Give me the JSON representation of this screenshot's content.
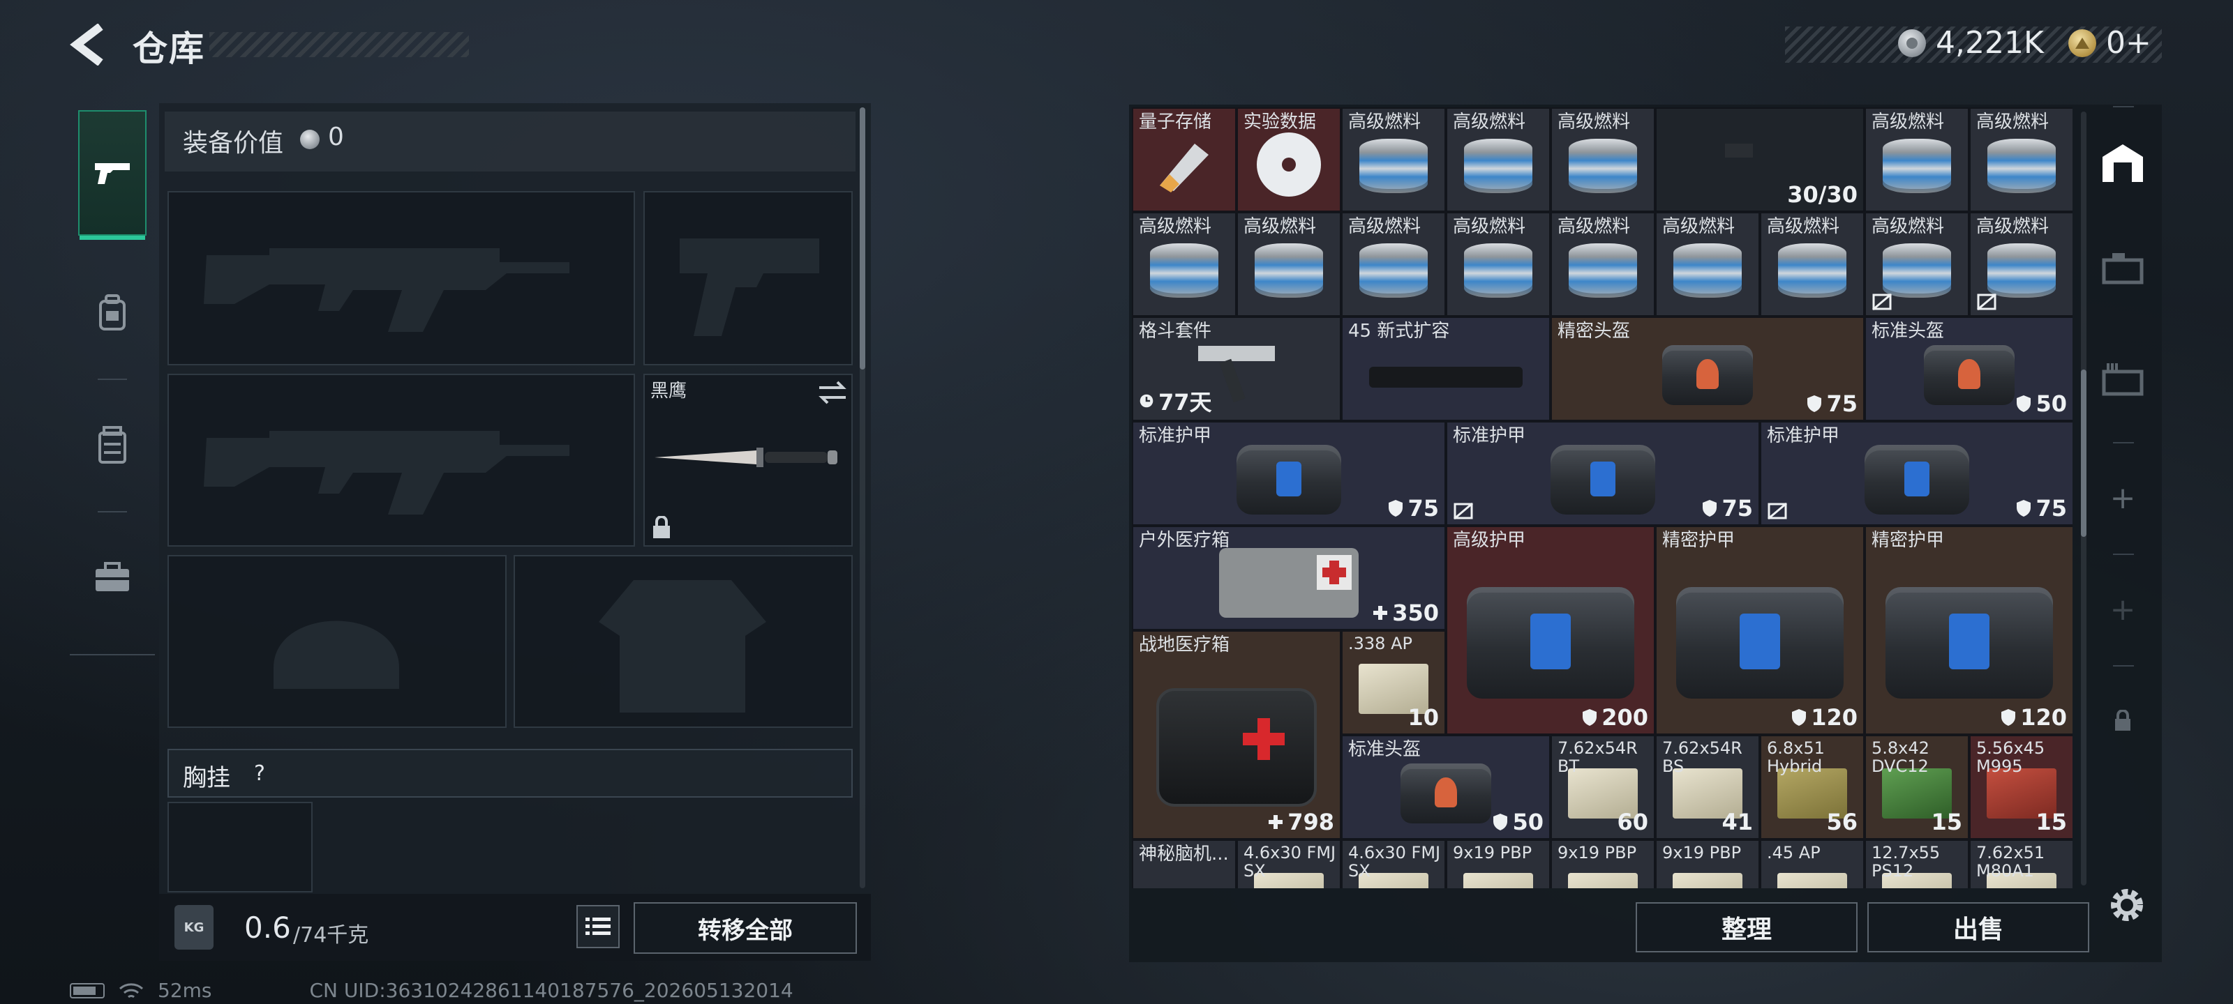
{
  "header": {
    "title": "仓库",
    "currency_silver": "4,221K",
    "currency_gold": "0+"
  },
  "loadout": {
    "equip_value_label": "装备价值",
    "equip_value": "0",
    "melee_name": "黑鹰",
    "chest_label": "胸挂",
    "chest_help": "?",
    "weight_icon_text": "KG",
    "weight_current": "0.6",
    "weight_max": "/74千克",
    "transfer_all": "转移全部"
  },
  "stash": {
    "sort_label": "整理",
    "sell_label": "出售",
    "items": [
      {
        "name": "量子存储",
        "val": "",
        "kind": "usb",
        "color": "c-red"
      },
      {
        "name": "实验数据",
        "val": "",
        "kind": "disc",
        "color": "c-red"
      },
      {
        "name": "高级燃料",
        "val": "",
        "kind": "can",
        "color": "c-norm"
      },
      {
        "name": "高级燃料",
        "val": "",
        "kind": "can",
        "color": "c-norm"
      },
      {
        "name": "高级燃料",
        "val": "",
        "kind": "can",
        "color": "c-norm"
      },
      {
        "name": "",
        "val": "30/30",
        "kind": "mag",
        "color": "c-dark"
      },
      {
        "name": "高级燃料",
        "val": "",
        "kind": "can",
        "color": "c-norm"
      },
      {
        "name": "高级燃料",
        "val": "",
        "kind": "can",
        "color": "c-norm"
      },
      {
        "name": "高级燃料",
        "val": "",
        "kind": "can",
        "color": "c-norm"
      },
      {
        "name": "高级燃料",
        "val": "",
        "kind": "can",
        "color": "c-norm"
      },
      {
        "name": "高级燃料",
        "val": "",
        "kind": "can",
        "color": "c-norm"
      },
      {
        "name": "高级燃料",
        "val": "",
        "kind": "can",
        "color": "c-norm"
      },
      {
        "name": "高级燃料",
        "val": "",
        "kind": "can",
        "color": "c-norm"
      },
      {
        "name": "高级燃料",
        "val": "",
        "kind": "can",
        "color": "c-norm"
      },
      {
        "name": "高级燃料",
        "val": "",
        "kind": "can",
        "color": "c-norm"
      },
      {
        "name": "高级燃料",
        "val": "",
        "kind": "can",
        "color": "c-norm",
        "flag": true
      },
      {
        "name": "高级燃料",
        "val": "",
        "kind": "can",
        "color": "c-norm",
        "flag": true
      },
      {
        "name": "格斗套件",
        "val": "77天",
        "kind": "gun",
        "color": "c-norm",
        "valicon": "clock"
      },
      {
        "name": "45 新式扩容",
        "val": "",
        "kind": "stock",
        "color": "c-blue"
      },
      {
        "name": "精密头盔",
        "val": "75",
        "kind": "helm",
        "color": "c-gold",
        "valicon": "shield"
      },
      {
        "name": "标准头盔",
        "val": "50",
        "kind": "helm",
        "color": "c-blue",
        "valicon": "shield"
      },
      {
        "name": "标准护甲",
        "val": "75",
        "kind": "vest",
        "color": "c-blue",
        "valicon": "shield"
      },
      {
        "name": "标准护甲",
        "val": "75",
        "kind": "vest",
        "color": "c-blue",
        "valicon": "shield",
        "flag": true
      },
      {
        "name": "标准护甲",
        "val": "75",
        "kind": "vest",
        "color": "c-blue",
        "valicon": "shield",
        "flag": true
      },
      {
        "name": "户外医疗箱",
        "val": "350",
        "kind": "medbag",
        "color": "c-blue",
        "valicon": "plus"
      },
      {
        "name": "高级护甲",
        "val": "200",
        "kind": "vest",
        "color": "c-red",
        "valicon": "shield"
      },
      {
        "name": "精密护甲",
        "val": "120",
        "kind": "vest",
        "color": "c-gold",
        "valicon": "shield"
      },
      {
        "name": "精密护甲",
        "val": "120",
        "kind": "vest",
        "color": "c-gold",
        "valicon": "shield"
      },
      {
        "name": "战地医疗箱",
        "val": "798",
        "kind": "medkit",
        "color": "c-gold",
        "valicon": "plus"
      },
      {
        "name": ".338 AP",
        "val": "10",
        "kind": "ammo",
        "color": "c-gold"
      },
      {
        "name": "标准头盔",
        "val": "50",
        "kind": "helm",
        "color": "c-blue",
        "valicon": "shield"
      },
      {
        "name": "7.62x54R BT",
        "val": "60",
        "kind": "ammo",
        "color": "c-norm"
      },
      {
        "name": "7.62x54R BS",
        "val": "41",
        "kind": "ammo",
        "color": "c-norm"
      },
      {
        "name": "6.8x51 Hybrid",
        "val": "56",
        "kind": "ammo-olive",
        "color": "c-gold"
      },
      {
        "name": "5.8x42 DVC12",
        "val": "15",
        "kind": "ammo-green",
        "color": "c-gold"
      },
      {
        "name": "5.56x45 M995",
        "val": "15",
        "kind": "ammo-red",
        "color": "c-red"
      },
      {
        "name": "神秘脑机...",
        "val": "",
        "kind": "none",
        "color": "c-norm"
      },
      {
        "name": "4.6x30 FMJ SX",
        "val": "",
        "kind": "ammo",
        "color": "c-norm"
      },
      {
        "name": "4.6x30 FMJ SX",
        "val": "",
        "kind": "ammo",
        "color": "c-norm"
      },
      {
        "name": "9x19 PBP",
        "val": "",
        "kind": "ammo",
        "color": "c-norm"
      },
      {
        "name": "9x19 PBP",
        "val": "",
        "kind": "ammo",
        "color": "c-norm"
      },
      {
        "name": "9x19 PBP",
        "val": "",
        "kind": "ammo",
        "color": "c-norm"
      },
      {
        "name": ".45 AP",
        "val": "",
        "kind": "ammo",
        "color": "c-norm"
      },
      {
        "name": "12.7x55 PS12",
        "val": "",
        "kind": "ammo",
        "color": "c-norm"
      },
      {
        "name": "7.62x51 M80A1",
        "val": "",
        "kind": "ammo",
        "color": "c-norm"
      }
    ]
  },
  "status": {
    "ping": "52ms",
    "uid": "CN UID:3631024286114018​7576_202605132014"
  },
  "colors": {
    "accent_green": "#2cc79a",
    "rarity_red": "#4a2528",
    "rarity_gold": "#3d3029",
    "rarity_blue": "#2a2d3e"
  }
}
